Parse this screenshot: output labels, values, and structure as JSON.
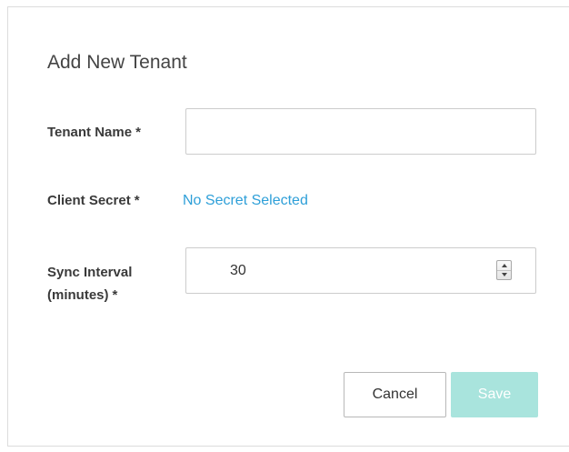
{
  "dialog": {
    "title": "Add New Tenant"
  },
  "form": {
    "tenant_name": {
      "label": "Tenant Name",
      "required_mark": "*",
      "value": ""
    },
    "client_secret": {
      "label": "Client Secret",
      "required_mark": "*",
      "value": "No Secret Selected"
    },
    "sync_interval": {
      "label_line1": "Sync Interval",
      "label_line2": "(minutes)",
      "required_mark": "*",
      "value": "30"
    }
  },
  "actions": {
    "cancel_label": "Cancel",
    "save_label": "Save"
  },
  "colors": {
    "link": "#2e9fd8",
    "save_disabled_bg": "#a9e4dd"
  },
  "icons": {
    "stepper_up": "chevron-up-icon",
    "stepper_down": "chevron-down-icon"
  }
}
